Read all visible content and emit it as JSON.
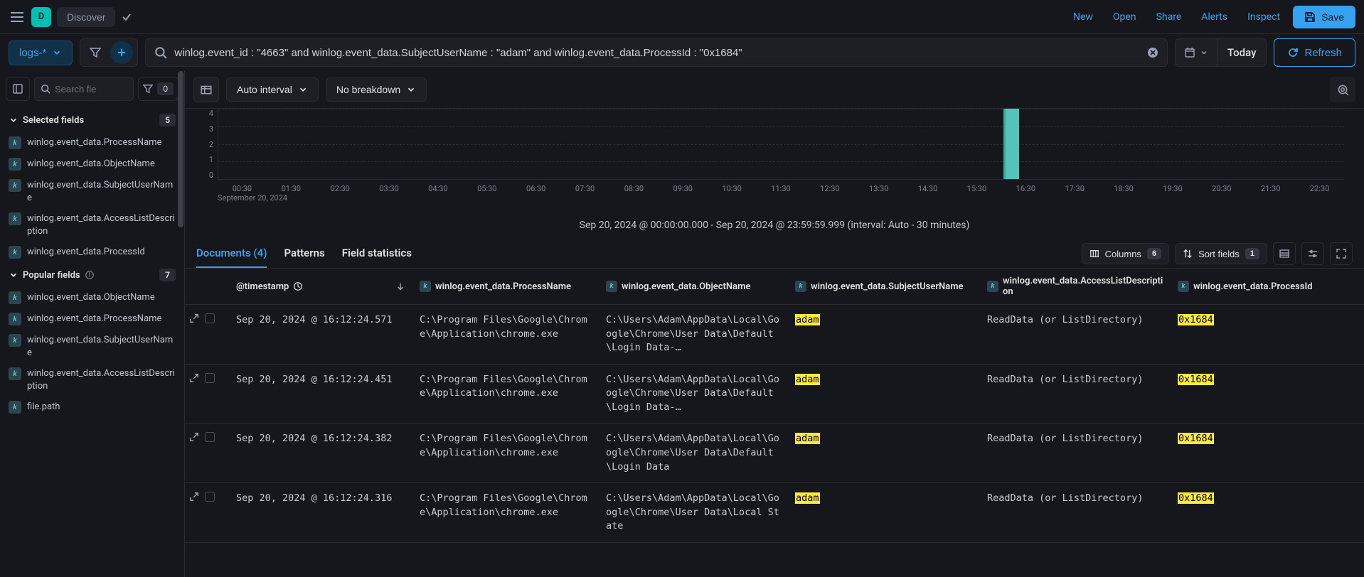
{
  "topnav": {
    "app_initial": "D",
    "breadcrumb": "Discover",
    "links": [
      "New",
      "Open",
      "Share",
      "Alerts",
      "Inspect"
    ],
    "save_label": "Save"
  },
  "querybar": {
    "index_pattern": "logs-*",
    "query": "winlog.event_id : \"4663\" and winlog.event_data.SubjectUserName : \"adam\" and winlog.event_data.ProcessId : \"0x1684\"",
    "date_label": "Today",
    "refresh_label": "Refresh"
  },
  "sidebar": {
    "search_placeholder": "Search fie",
    "filter_count": "0",
    "sections": {
      "selected": {
        "title": "Selected fields",
        "count": "5"
      },
      "popular": {
        "title": "Popular fields",
        "count": "7"
      }
    },
    "selected_fields": [
      {
        "type": "k",
        "name": "winlog.event_data.ProcessName"
      },
      {
        "type": "k",
        "name": "winlog.event_data.ObjectName"
      },
      {
        "type": "k",
        "name": "winlog.event_data.SubjectUserName"
      },
      {
        "type": "k",
        "name": "winlog.event_data.AccessListDescription"
      },
      {
        "type": "k",
        "name": "winlog.event_data.ProcessId"
      }
    ],
    "popular_fields": [
      {
        "type": "k",
        "name": "winlog.event_data.ObjectName"
      },
      {
        "type": "k",
        "name": "winlog.event_data.ProcessName"
      },
      {
        "type": "k",
        "name": "winlog.event_data.SubjectUserName"
      },
      {
        "type": "k",
        "name": "winlog.event_data.AccessListDescription"
      },
      {
        "type": "k",
        "name": "file.path"
      }
    ]
  },
  "histobar": {
    "interval": "Auto interval",
    "breakdown": "No breakdown"
  },
  "chart_data": {
    "type": "bar",
    "categories_x": [
      "00:30",
      "01:30",
      "02:30",
      "03:30",
      "04:30",
      "05:30",
      "06:30",
      "07:30",
      "08:30",
      "09:30",
      "10:30",
      "11:30",
      "12:30",
      "13:30",
      "14:30",
      "15:30",
      "16:30",
      "17:30",
      "18:30",
      "19:30",
      "20:30",
      "21:30",
      "22:30"
    ],
    "y_ticks": [
      "4",
      "3",
      "2",
      "1",
      "0"
    ],
    "bars": [
      {
        "x": "16:00",
        "value": 4
      }
    ],
    "title": "",
    "xlabel": "",
    "ylabel": "",
    "date_label_under": "September 20, 2024",
    "ylim": [
      0,
      4
    ]
  },
  "histo_summary": "Sep 20, 2024 @ 00:00:00.000 - Sep 20, 2024 @ 23:59:59.999 (interval: Auto - 30 minutes)",
  "tabs": {
    "documents": "Documents (4)",
    "patterns": "Patterns",
    "field_stats": "Field statistics"
  },
  "table_controls": {
    "columns_label": "Columns",
    "columns_count": "6",
    "sort_label": "Sort fields",
    "sort_count": "1"
  },
  "columns": {
    "timestamp": "@timestamp",
    "process": "winlog.event_data.ProcessName",
    "object": "winlog.event_data.ObjectName",
    "user": "winlog.event_data.SubjectUserName",
    "acl": "winlog.event_data.AccessListDescription",
    "pid": "winlog.event_data.ProcessId"
  },
  "rows": [
    {
      "timestamp": "Sep 20, 2024 @ 16:12:24.571",
      "process": "C:\\Program Files\\Google\\Chrome\\Application\\chrome.exe",
      "object": "C:\\Users\\Adam\\AppData\\Local\\Google\\Chrome\\User Data\\Default\\Login Data-…",
      "user": "adam",
      "acl": "ReadData (or ListDirectory)",
      "pid": "0x1684"
    },
    {
      "timestamp": "Sep 20, 2024 @ 16:12:24.451",
      "process": "C:\\Program Files\\Google\\Chrome\\Application\\chrome.exe",
      "object": "C:\\Users\\Adam\\AppData\\Local\\Google\\Chrome\\User Data\\Default\\Login Data-…",
      "user": "adam",
      "acl": "ReadData (or ListDirectory)",
      "pid": "0x1684"
    },
    {
      "timestamp": "Sep 20, 2024 @ 16:12:24.382",
      "process": "C:\\Program Files\\Google\\Chrome\\Application\\chrome.exe",
      "object": "C:\\Users\\Adam\\AppData\\Local\\Google\\Chrome\\User Data\\Default\\Login Data",
      "user": "adam",
      "acl": "ReadData (or ListDirectory)",
      "pid": "0x1684"
    },
    {
      "timestamp": "Sep 20, 2024 @ 16:12:24.316",
      "process": "C:\\Program Files\\Google\\Chrome\\Application\\chrome.exe",
      "object": "C:\\Users\\Adam\\AppData\\Local\\Google\\Chrome\\User Data\\Local State",
      "user": "adam",
      "acl": "ReadData (or ListDirectory)",
      "pid": "0x1684"
    }
  ]
}
